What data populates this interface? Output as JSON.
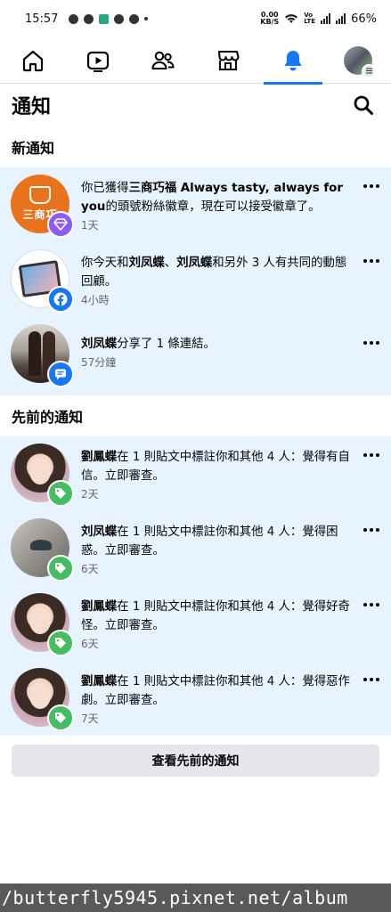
{
  "status_bar": {
    "time": "15:57",
    "speed_value": "0.00",
    "speed_unit": "KB/S",
    "battery": "66%"
  },
  "nav": {
    "items": [
      {
        "icon": "home-icon"
      },
      {
        "icon": "video-icon"
      },
      {
        "icon": "friends-icon"
      },
      {
        "icon": "marketplace-icon"
      },
      {
        "icon": "bell-icon",
        "active": true
      },
      {
        "icon": "profile-avatar"
      }
    ],
    "accent_color": "#1877f2"
  },
  "header": {
    "title": "通知"
  },
  "sections": {
    "new_title": "新通知",
    "earlier_title": "先前的通知"
  },
  "new_notifications": [
    {
      "parts": [
        "你已獲得",
        "三商巧福 Always tasty, always for you",
        "的頭號粉絲徽章，現在可以接受徽章了。"
      ],
      "time": "1天",
      "avatar_text": "三商巧",
      "badge": "diamond-icon"
    },
    {
      "parts": [
        "你今天和",
        "刘凤蝶",
        "、",
        "刘凤蝶",
        "和另外 3 人有共同的動態回顧。"
      ],
      "time": "4小時",
      "badge": "facebook-icon"
    },
    {
      "parts": [
        "刘凤蝶",
        "分享了 1 條連結。"
      ],
      "time": "57分鐘",
      "badge": "message-icon"
    }
  ],
  "earlier_notifications": [
    {
      "parts": [
        "劉鳳蝶",
        "在 1 則貼文中標註你和其他 4 人：覺得有自信。立即審查。"
      ],
      "time": "2天",
      "badge": "tag-icon"
    },
    {
      "parts": [
        "刘凤蝶",
        "在 1 則貼文中標註你和其他 4 人：覺得困惑。立即審查。"
      ],
      "time": "6天",
      "badge": "tag-icon"
    },
    {
      "parts": [
        "劉鳳蝶",
        "在 1 則貼文中標註你和其他 4 人：覺得好奇怪。立即審查。"
      ],
      "time": "6天",
      "badge": "tag-icon"
    },
    {
      "parts": [
        "劉鳳蝶",
        "在 1 則貼文中標註你和其他 4 人：覺得惡作劇。立即審查。"
      ],
      "time": "7天",
      "badge": "tag-icon"
    }
  ],
  "view_previous_label": "查看先前的通知",
  "watermark": "/butterfly5945.pixnet.net/album"
}
